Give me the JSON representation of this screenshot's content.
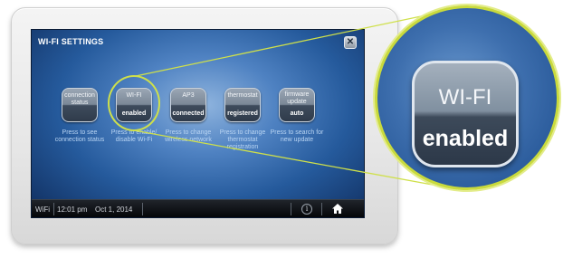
{
  "screen": {
    "title": "WI-FI SETTINGS",
    "close_label": "✕"
  },
  "tiles": [
    {
      "line1": "connection",
      "line2": "status",
      "caption": "Press to see connection status"
    },
    {
      "line1": "WI-FI",
      "line2": "enabled",
      "caption": "Press to enable/ disable Wi-Fi"
    },
    {
      "line1": "AP3",
      "line2": "connected",
      "caption": "Press to change wireless network"
    },
    {
      "line1": "thermostat",
      "line2": "registered",
      "caption": "Press to change thermostat registration"
    },
    {
      "line1": "firmware update",
      "line2": "auto",
      "caption": "Press to search for new update"
    }
  ],
  "status_bar": {
    "wifi_label": "WiFi",
    "time": "12:01 pm",
    "date": "Oct 1, 2014",
    "info_symbol": "i"
  },
  "magnified_tile": {
    "line1": "WI-FI",
    "line2": "enabled"
  },
  "colors": {
    "highlight": "#c9da3c",
    "screen_blue": "#255a9c"
  }
}
